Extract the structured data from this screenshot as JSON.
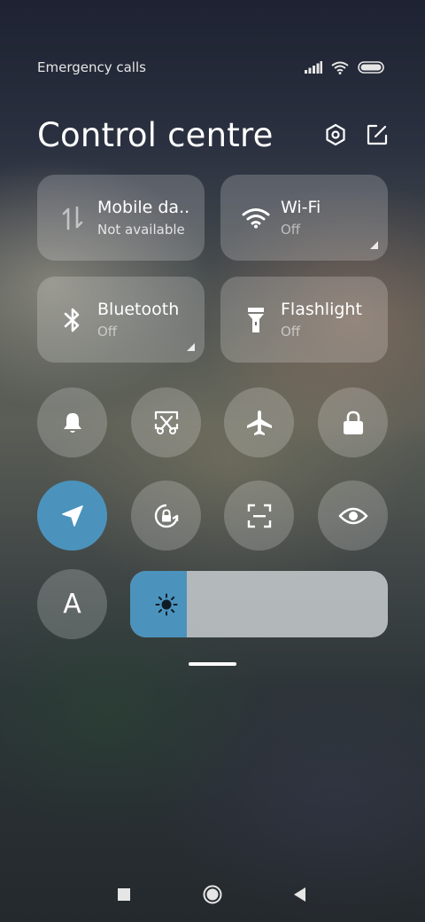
{
  "status_bar": {
    "carrier_text": "Emergency calls o",
    "icons": [
      "signal-icon",
      "wifi-icon",
      "battery-icon"
    ]
  },
  "header": {
    "title": "Control centre",
    "icons": [
      "settings-icon",
      "edit-icon"
    ]
  },
  "tiles": [
    {
      "id": "mobile-data",
      "label": "Mobile da..",
      "status": "Not available",
      "icon": "mobile-data-icon",
      "has_corner": false
    },
    {
      "id": "wifi",
      "label": "Wi-Fi",
      "status": "Off",
      "icon": "wifi-icon",
      "has_corner": true
    },
    {
      "id": "bluetooth",
      "label": "Bluetooth",
      "status": "Off",
      "icon": "bluetooth-icon",
      "has_corner": true
    },
    {
      "id": "flashlight",
      "label": "Flashlight",
      "status": "Off",
      "icon": "flashlight-icon",
      "has_corner": false
    }
  ],
  "toggles_row1": [
    "bell-icon",
    "screenshot-icon",
    "airplane-icon",
    "lock-icon"
  ],
  "toggles_row2": [
    "location-icon",
    "rotation-lock-icon",
    "scanner-icon",
    "eye-icon"
  ],
  "auto_brightness": {
    "label": "A",
    "icon": "auto-brightness-icon"
  },
  "brightness": {
    "level_percent": 22,
    "icon": "sun-icon"
  },
  "colors": {
    "accent": "#4b93bd",
    "tile_bg": "rgba(255,255,255,0.2)"
  },
  "navigation": [
    "recents-icon",
    "home-icon",
    "back-icon"
  ]
}
